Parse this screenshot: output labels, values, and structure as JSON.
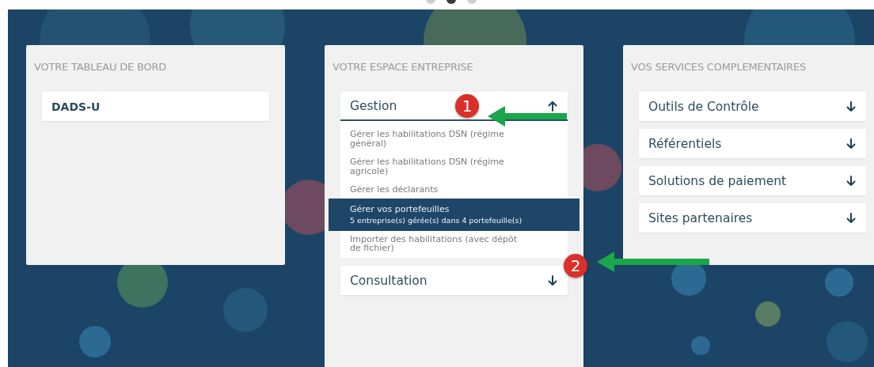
{
  "carousel": {
    "dots": [
      {
        "selected": false
      },
      {
        "selected": true
      },
      {
        "selected": false
      }
    ]
  },
  "panels": [
    {
      "title": "VOTRE TABLEAU DE BORD",
      "items": [
        {
          "kind": "link",
          "label": "DADS-U"
        }
      ]
    },
    {
      "title": "VOTRE ESPACE ENTREPRISE",
      "items": [
        {
          "kind": "section",
          "label": "Gestion",
          "expanded": true,
          "children": [
            {
              "label": "Gérer les habilitations DSN (régime général)",
              "selected": false
            },
            {
              "label": "Gérer les habilitations DSN (régime agricole)",
              "selected": false
            },
            {
              "label": "Gérer les déclarants",
              "selected": false
            },
            {
              "label": "Gérer vos portefeuilles",
              "detail": "5 entreprise(s) gérée(s) dans 4 portefeuille(s)",
              "selected": true
            },
            {
              "label": "Importer des habilitations (avec dépôt de fichier)",
              "selected": false
            }
          ]
        },
        {
          "kind": "section",
          "label": "Consultation",
          "expanded": false
        }
      ]
    },
    {
      "title": "VOS SERVICES COMPLEMENTAIRES",
      "items": [
        {
          "kind": "section",
          "label": "Outils de Contrôle",
          "expanded": false
        },
        {
          "kind": "section",
          "label": "Référentiels",
          "expanded": false
        },
        {
          "kind": "section",
          "label": "Solutions de paiement",
          "expanded": false
        },
        {
          "kind": "section",
          "label": "Sites partenaires",
          "expanded": false
        }
      ]
    }
  ],
  "annotations": [
    {
      "label": "1"
    },
    {
      "label": "2"
    }
  ]
}
